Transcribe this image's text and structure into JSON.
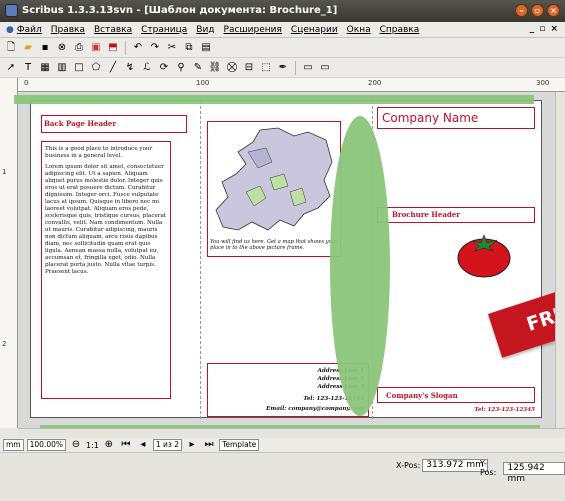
{
  "window": {
    "title": "Scribus 1.3.3.13svn - [Шаблон документа: Brochure_1]",
    "minimize": "–",
    "maximize": "▫",
    "close": "×"
  },
  "menu": [
    "Файл",
    "Правка",
    "Вставка",
    "Страница",
    "Вид",
    "Расширения",
    "Сценарии",
    "Окна",
    "Справка"
  ],
  "mdi_controls": "_ ▫ ×",
  "ruler": {
    "h_marks": [
      "0",
      "100",
      "200",
      "300"
    ],
    "v_marks": [
      "1",
      "2"
    ]
  },
  "document": {
    "back_page_header": "Back Page Header",
    "back_text_intro": "This is a good place to introduce your business in a general level.",
    "back_text_body": "Lorem ipsum dolor sit amet, consectetuer adipiscing elit. Ut a sapien. Aliquam aliquet purus molestie dolor. Integer quis eros ut erat posuere dictum. Curabitur dignissim. Integer orci. Fusce vulputate lacus at ipsum. Quisque in libero nec mi laoreet volutpat. Aliquam eros pede, scelerisque quis, tristique cursus, placerat convallis, velit. Nam condimentum. Nulla ut mauris. Curabitur adipiscing, mauris non dictum aliquam, arcu risus dapibus diam, nec sollicitudin quam erat quis ligula. Aenean massa nulla, volutpat eu, accumsan et, fringilla eget, odio. Nulla placerat porta justo. Nulla vitae turpis. Praesent lacus.",
    "map_caption": "You will find us here. Get a map that shows your place in to the above picture frame.",
    "address": [
      "Address Line 1",
      "Address Line 2",
      "Address Line 3"
    ],
    "tel_middle": "Tel: 123-123-12345",
    "email": "Email: company@company.com",
    "company_name": "Company Name",
    "brochure_header": "Brochure Header",
    "slogan": "Company's Slogan",
    "tel_right": "Tel: 123-123-12345"
  },
  "badge": "FREE",
  "status": {
    "unit": "mm",
    "zoom": "100.00%",
    "ratio": "1:1",
    "page": "1 из 2",
    "layer": "Template"
  },
  "position": {
    "x_label": "X-Pos:",
    "x_value": "313.972 mm",
    "y_label": "Y-Pos:",
    "y_value": "125.942 mm"
  },
  "colors": {
    "accent_red": "#c0112b",
    "highlight_green": "#8bc57a",
    "badge_red": "#c5151f"
  },
  "icons": {
    "map": "europe-map",
    "fruit": "tomato"
  }
}
